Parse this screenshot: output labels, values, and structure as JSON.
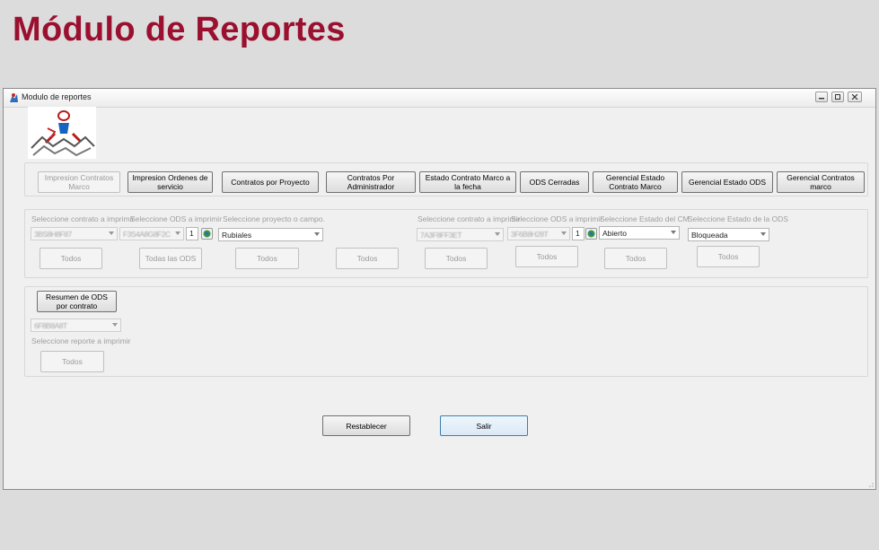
{
  "slide_title": "Módulo de Reportes",
  "window": {
    "title": "Modulo de reportes"
  },
  "toolbar": [
    "Impresion Contratos Marco",
    "Impresion Ordenes de servicio",
    "Contratos por Proyecto",
    "Contratos Por Administrador",
    "Estado Contrato Marco  a la fecha",
    "ODS Cerradas",
    "Gerencial Estado Contrato Marco",
    "Gerencial Estado ODS",
    "Gerencial Contratos marco"
  ],
  "filters": {
    "contrato_label": "Seleccione contrato a imprimir",
    "contrato_value": "3BS8H8F87",
    "ods_label": "Seleccione ODS a imprimir",
    "ods_value": "F3S4A8G8F2C",
    "ods_num": "1",
    "proyecto_label": "Seleccione proyecto o campo.",
    "proyecto_value": "Rubiales",
    "contrato2_label": "Seleccione contrato a imprimir",
    "contrato2_value": "7A3F8FF3ET",
    "ods2_label": "Seleccione ODS a imprimir",
    "ods2_value": "3F6B8H28T",
    "ods2_num": "1",
    "estado_cm_label": "Seleccione Estado del CM",
    "estado_cm_value": "Abierto",
    "estado_ods_label": "Seleccione Estado de la ODS",
    "estado_ods_value": "Bloqueada"
  },
  "todos_buttons": [
    "Todos",
    "Todas las ODS",
    "Todos",
    "Todos",
    "Todos",
    "Todos",
    "Todos",
    "Todos"
  ],
  "resumen": {
    "button": "Resumen de ODS por contrato",
    "combo_value": "6F8B8A8T",
    "label": "Seleccione reporte a imprimir",
    "todos": "Todos"
  },
  "actions": {
    "reset": "Restablecer",
    "exit": "Salir"
  }
}
